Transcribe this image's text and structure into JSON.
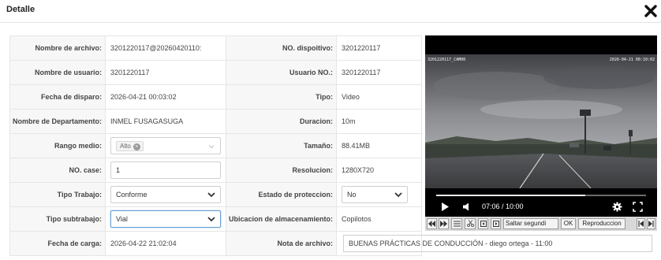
{
  "header": {
    "title": "Detalle"
  },
  "left": [
    {
      "label": "Nombre de archivo:",
      "value": "3201220117@20260420110:"
    },
    {
      "label": "Nombre de usuario:",
      "value": "3201220117"
    },
    {
      "label": "Fecha de disparo:",
      "value": "2026-04-21 00:03:02"
    },
    {
      "label": "Nombre de Departamento:",
      "value": "INMEL FUSAGASUGA"
    },
    {
      "label": "Rango medio:",
      "chip": "Alto"
    },
    {
      "label": "NO. case:",
      "value": "1"
    },
    {
      "label": "Tipo Trabajo:",
      "value": "Conforme"
    },
    {
      "label": "Tipo subtrabajo:",
      "value": "Vial"
    },
    {
      "label": "Fecha de carga:",
      "value": "2026-04-22 21:02:04"
    }
  ],
  "right": [
    {
      "label": "NO. dispoitivo:",
      "value": "3201220117"
    },
    {
      "label": "Usuario NO.:",
      "value": "3201220117"
    },
    {
      "label": "Tipo:",
      "value": "Video"
    },
    {
      "label": "Duracion:",
      "value": "10m"
    },
    {
      "label": "Tamaño:",
      "value": "88.41MB"
    },
    {
      "label": "Resolucion:",
      "value": "1280X720"
    },
    {
      "label": "Estado de proteccion:",
      "value": "No"
    },
    {
      "label": "Ubicacion de almacenamiento:",
      "value": "Copilotos"
    },
    {
      "label": "Nota de archivo:",
      "value": "BUENAS PRÁCTICAS DE CONDUCCIÓN - diego ortega - 11:00"
    }
  ],
  "video": {
    "overlay_left": "3201220117_CAM00",
    "overlay_right": "2026-04-21 00:10:02",
    "time": "07:06 / 10:00",
    "progress": 0.71,
    "buttons": {
      "skip": "Saltar segundi",
      "ok": "OK",
      "play": "Reproduccion"
    }
  }
}
